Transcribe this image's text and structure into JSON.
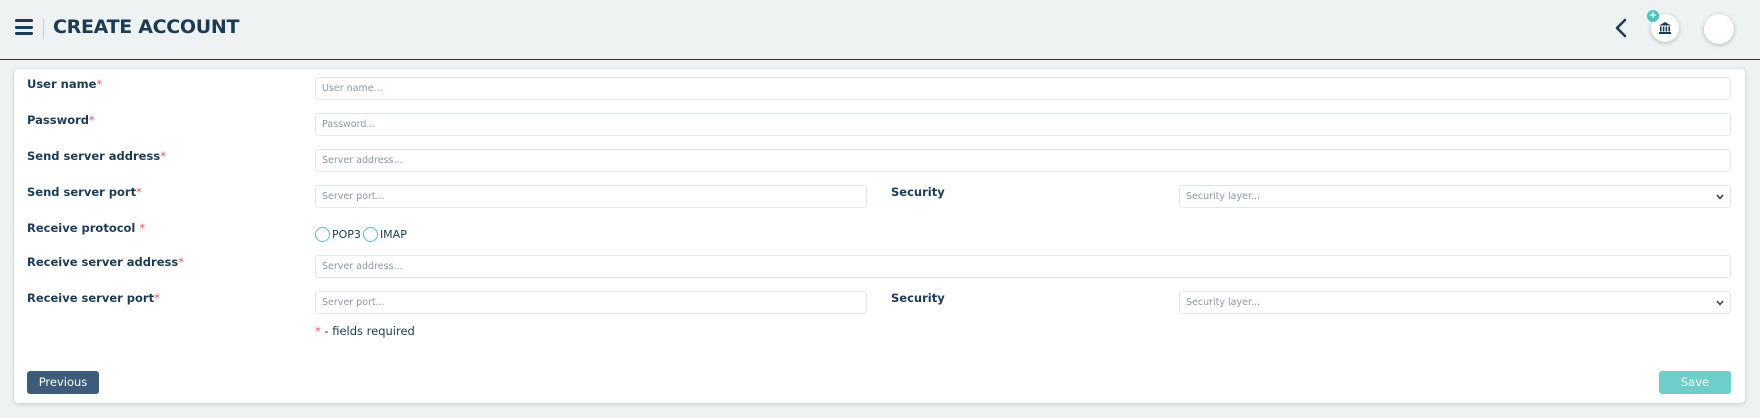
{
  "header": {
    "title": "CREATE ACCOUNT",
    "menu_icon": "hamburger-menu-icon",
    "back_icon": "chevron-left-icon",
    "bank_icon": "bank-icon",
    "plus_badge": "+"
  },
  "form": {
    "username": {
      "label": "User name",
      "required": "*",
      "placeholder": "User name..."
    },
    "password": {
      "label": "Password",
      "required": "*",
      "placeholder": "Password..."
    },
    "send_address": {
      "label": "Send server address",
      "required": "*",
      "placeholder": "Server address..."
    },
    "send_port": {
      "label": "Send server port",
      "required": "*",
      "placeholder": "Server port..."
    },
    "send_security": {
      "label": "Security",
      "placeholder": "Security layer..."
    },
    "receive_protocol": {
      "label": "Receive protocol ",
      "required": "*",
      "options": [
        "POP3",
        "IMAP"
      ]
    },
    "receive_address": {
      "label": "Receive server address",
      "required": "*",
      "placeholder": "Server address..."
    },
    "receive_port": {
      "label": "Receive server port",
      "required": "*",
      "placeholder": "Server port..."
    },
    "receive_security": {
      "label": "Security",
      "placeholder": "Security layer..."
    },
    "required_note": {
      "star": "*",
      "text": " - fields required"
    }
  },
  "buttons": {
    "previous": "Previous",
    "save": "Save"
  },
  "colors": {
    "primary": "#1d3b53",
    "accent": "#4cc3bd",
    "required": "#e05a5a",
    "previous_bg": "#3e5b79",
    "save_bg": "#6ecfca"
  }
}
